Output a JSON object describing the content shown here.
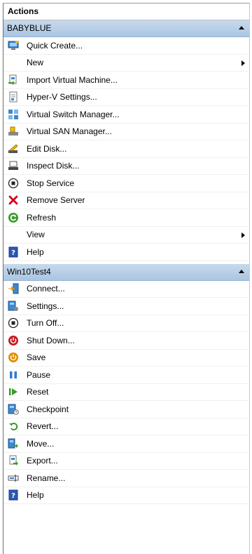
{
  "panel": {
    "title": "Actions"
  },
  "host": {
    "name": "BABYBLUE",
    "items": [
      {
        "label": "Quick Create...",
        "icon": "quick-create-icon"
      },
      {
        "label": "New",
        "icon": "none",
        "submenu": true
      },
      {
        "label": "Import Virtual Machine...",
        "icon": "import-vm-icon"
      },
      {
        "label": "Hyper-V Settings...",
        "icon": "hyperv-settings-icon"
      },
      {
        "label": "Virtual Switch Manager...",
        "icon": "virtual-switch-icon"
      },
      {
        "label": "Virtual SAN Manager...",
        "icon": "virtual-san-icon"
      },
      {
        "label": "Edit Disk...",
        "icon": "edit-disk-icon"
      },
      {
        "label": "Inspect Disk...",
        "icon": "inspect-disk-icon"
      },
      {
        "label": "Stop Service",
        "icon": "stop-service-icon"
      },
      {
        "label": "Remove Server",
        "icon": "remove-server-icon"
      },
      {
        "label": "Refresh",
        "icon": "refresh-icon"
      },
      {
        "label": "View",
        "icon": "none",
        "submenu": true
      },
      {
        "label": "Help",
        "icon": "help-icon"
      }
    ]
  },
  "vm": {
    "name": "Win10Test4",
    "items": [
      {
        "label": "Connect...",
        "icon": "connect-icon"
      },
      {
        "label": "Settings...",
        "icon": "settings-icon"
      },
      {
        "label": "Turn Off...",
        "icon": "turn-off-icon"
      },
      {
        "label": "Shut Down...",
        "icon": "shut-down-icon"
      },
      {
        "label": "Save",
        "icon": "save-icon"
      },
      {
        "label": "Pause",
        "icon": "pause-icon"
      },
      {
        "label": "Reset",
        "icon": "reset-icon"
      },
      {
        "label": "Checkpoint",
        "icon": "checkpoint-icon"
      },
      {
        "label": "Revert...",
        "icon": "revert-icon"
      },
      {
        "label": "Move...",
        "icon": "move-icon"
      },
      {
        "label": "Export...",
        "icon": "export-icon"
      },
      {
        "label": "Rename...",
        "icon": "rename-icon"
      },
      {
        "label": "Help",
        "icon": "help-icon"
      }
    ]
  },
  "colors": {
    "header_gradient_top": "#c7d9ec",
    "header_gradient_bottom": "#aac6e2",
    "remove_red": "#d0021b",
    "refresh_green": "#3a9a2a",
    "shutdown_red": "#c8161d",
    "save_orange": "#e48a00",
    "pause_blue": "#2f7bd1",
    "help_blue": "#2b57b3"
  }
}
